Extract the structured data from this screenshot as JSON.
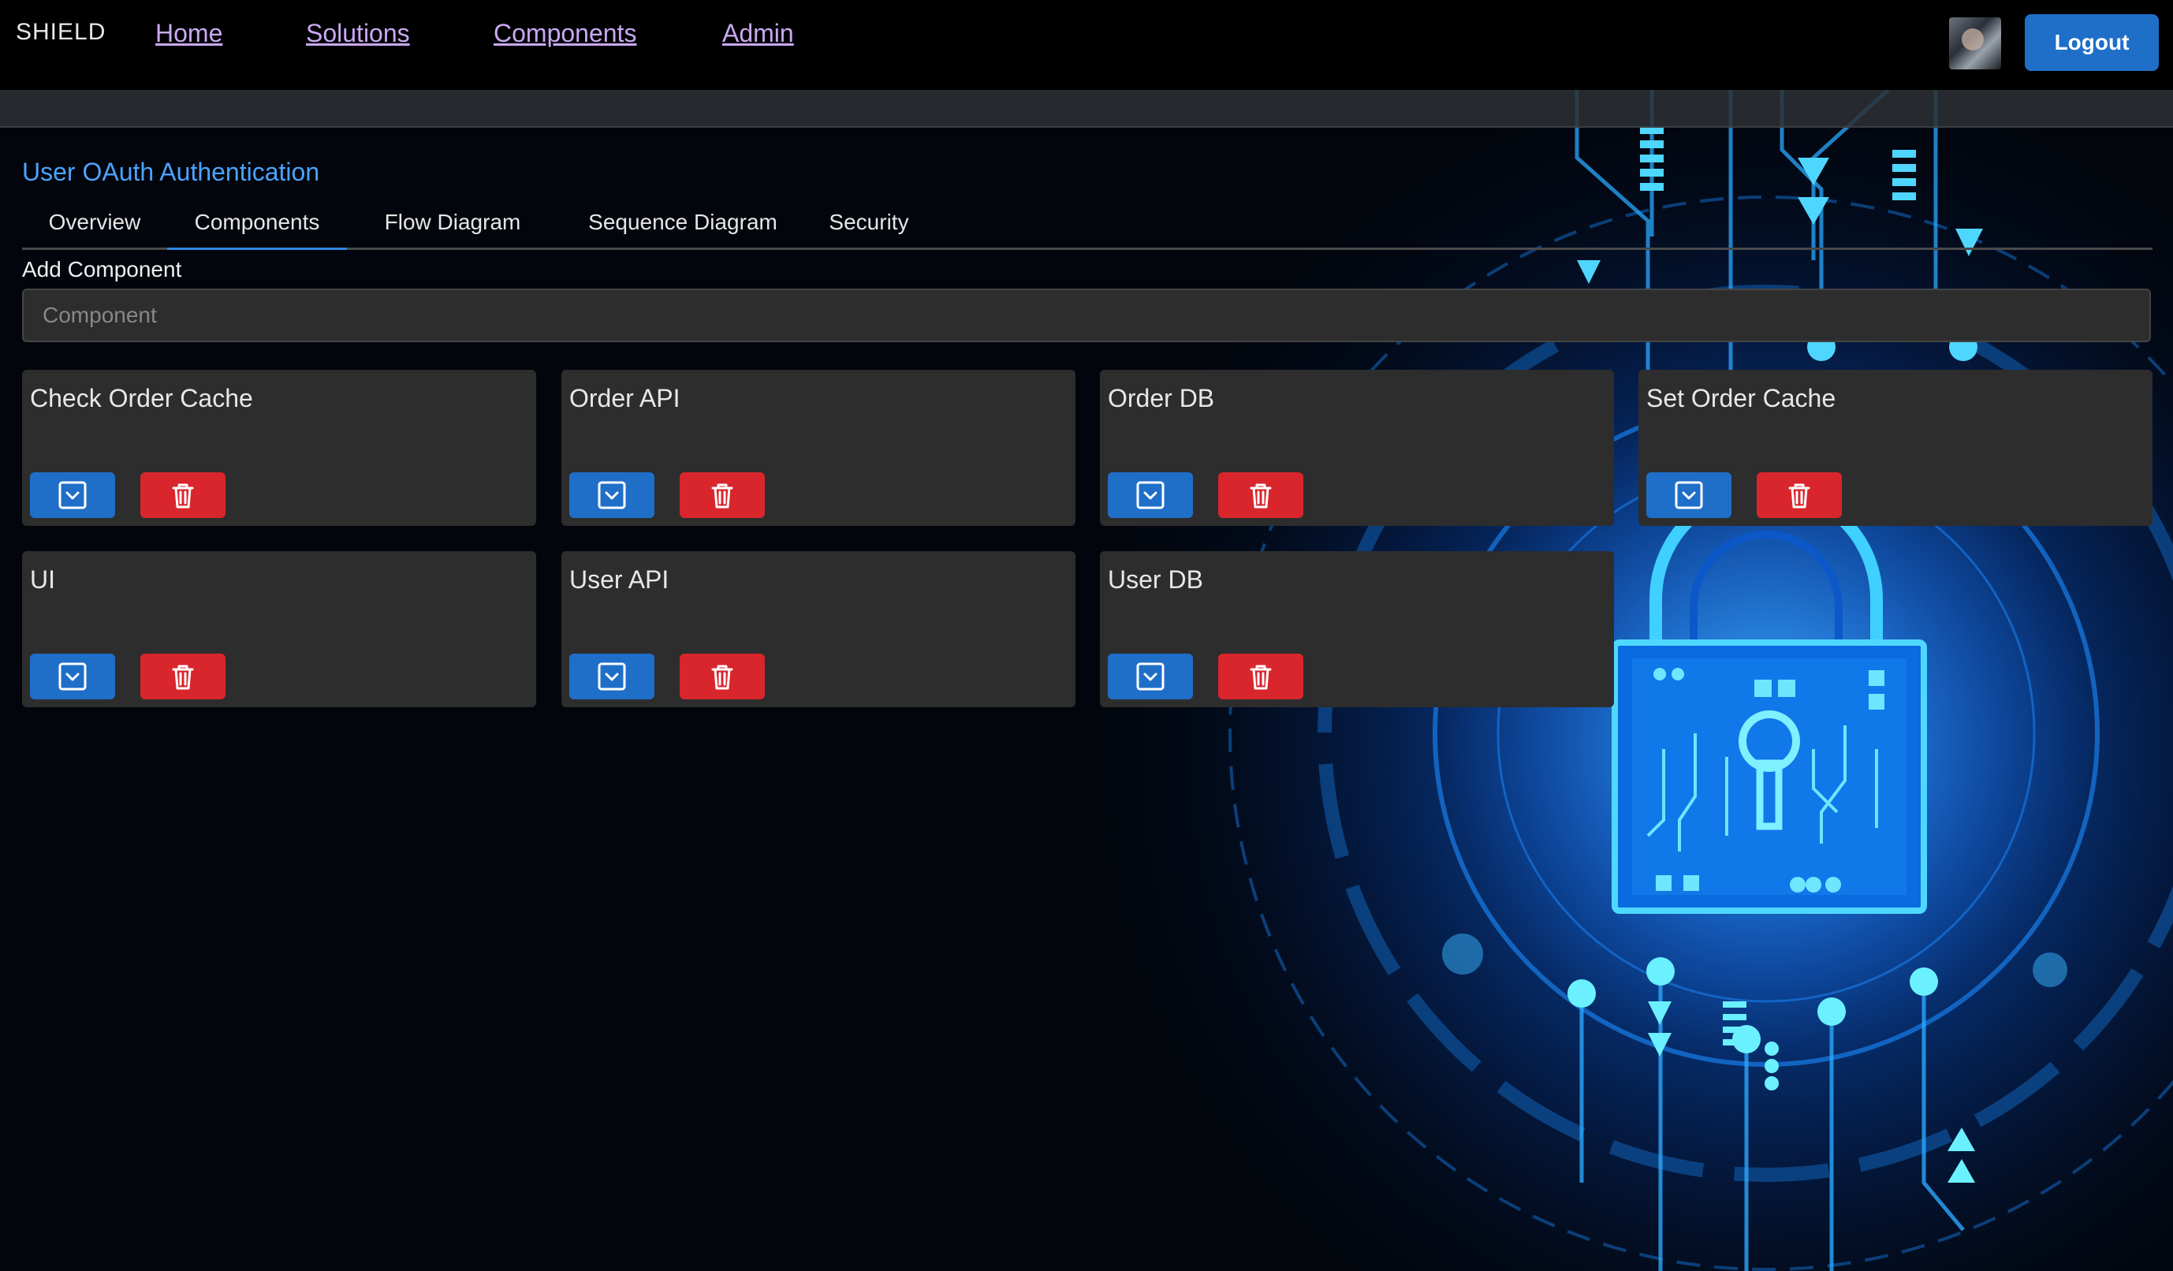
{
  "header": {
    "brand": "SHIELD",
    "nav": [
      {
        "label": "Home"
      },
      {
        "label": "Solutions"
      },
      {
        "label": "Components"
      },
      {
        "label": "Admin"
      }
    ],
    "logout_label": "Logout"
  },
  "page": {
    "title": "User OAuth Authentication",
    "tabs": [
      {
        "label": "Overview"
      },
      {
        "label": "Components",
        "active": true
      },
      {
        "label": "Flow Diagram"
      },
      {
        "label": "Sequence Diagram"
      },
      {
        "label": "Security"
      }
    ],
    "add_component": {
      "label": "Add Component",
      "placeholder": "Component",
      "value": ""
    },
    "components": [
      {
        "name": "Check Order Cache"
      },
      {
        "name": "Order API"
      },
      {
        "name": "Order DB"
      },
      {
        "name": "Set Order Cache"
      },
      {
        "name": "UI"
      },
      {
        "name": "User API"
      },
      {
        "name": "User DB"
      }
    ]
  },
  "icons": {
    "expand": "chevron-down-square-icon",
    "delete": "trash-icon"
  },
  "colors": {
    "accent_blue": "#1f6fc9",
    "danger_red": "#d8262c",
    "title_blue": "#4da3ff",
    "nav_link": "#c9a8f2",
    "card_bg": "#2d2d2d"
  }
}
